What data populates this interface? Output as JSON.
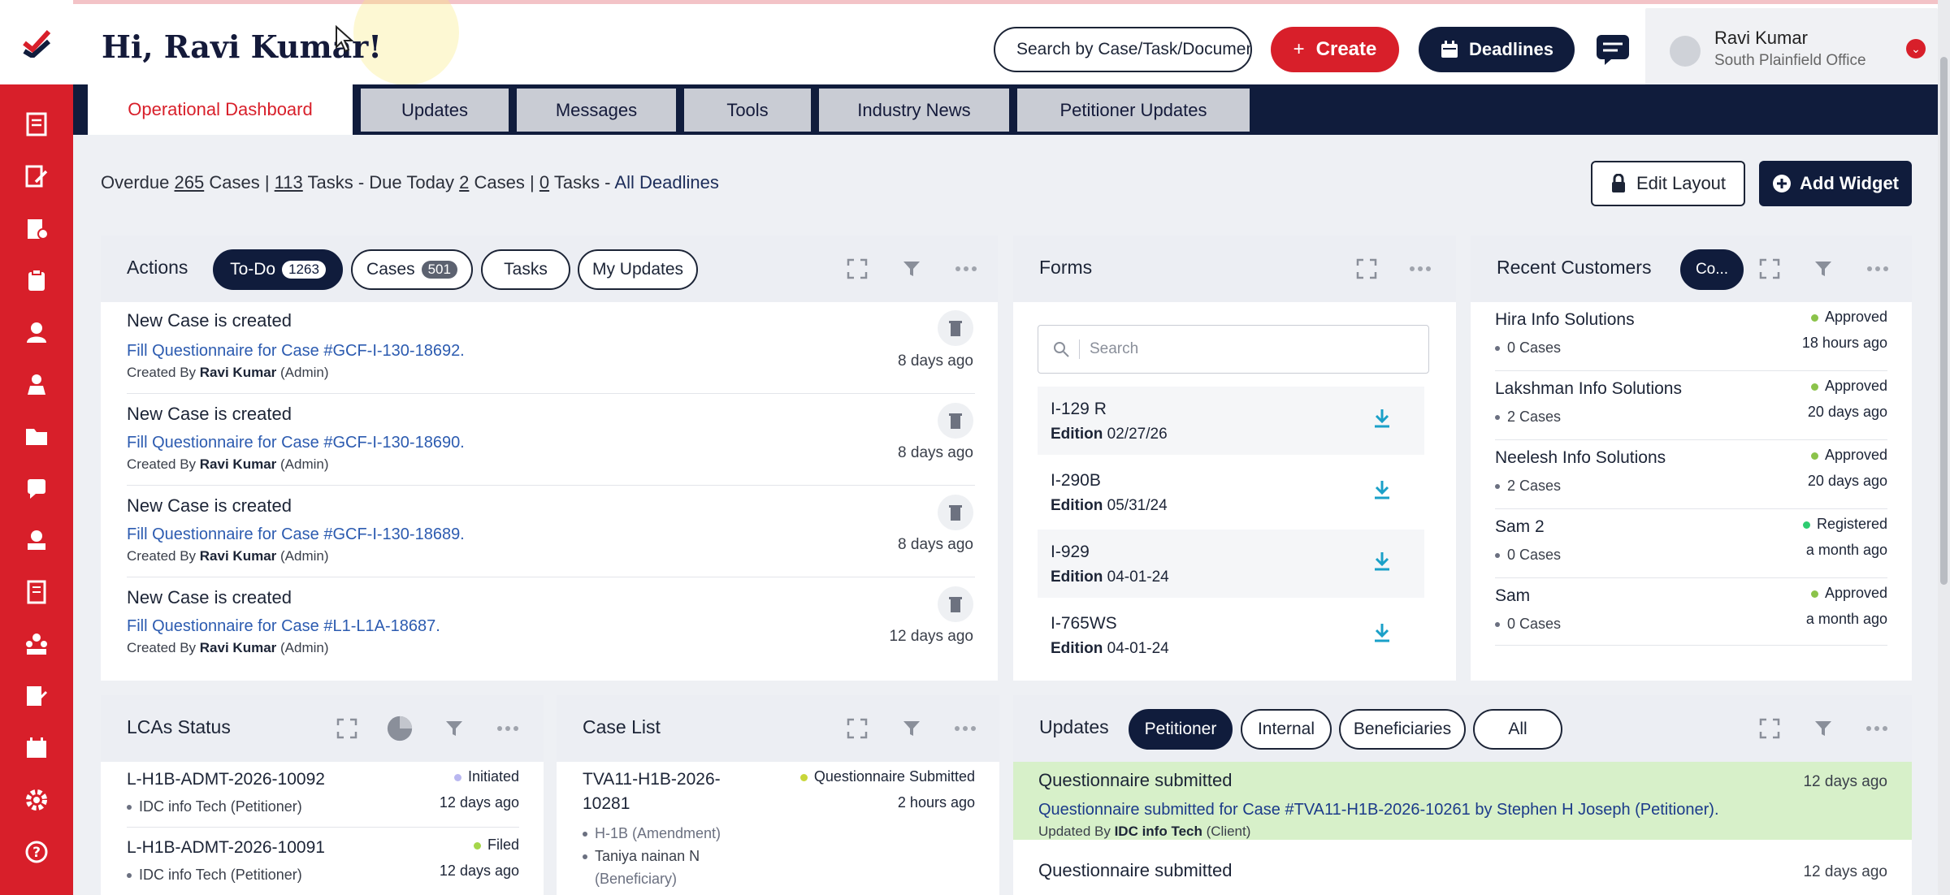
{
  "header": {
    "greeting": "Hi, Ravi Kumar!",
    "search_placeholder": "Search by Case/Task/Document",
    "create_label": "Create",
    "deadlines_label": "Deadlines",
    "user_name": "Ravi Kumar",
    "user_office": "South Plainfield Office"
  },
  "tabs": [
    "Operational Dashboard",
    "Updates",
    "Messages",
    "Tools",
    "Industry News",
    "Petitioner Updates"
  ],
  "summary": {
    "overdue_label": "Overdue",
    "overdue_cases": "265",
    "cases_word": "Cases |",
    "overdue_tasks": "113",
    "tasks_due_label": "Tasks - Due Today",
    "due_cases": "2",
    "cases_word2": "Cases |",
    "due_tasks": "0",
    "tasks_word": "Tasks -",
    "all_deadlines": "All Deadlines"
  },
  "buttons": {
    "edit_layout": "Edit Layout",
    "add_widget": "Add Widget"
  },
  "actions": {
    "title": "Actions",
    "pills": {
      "todo": "To-Do",
      "todo_count": "1263",
      "cases": "Cases",
      "cases_count": "501",
      "tasks": "Tasks",
      "my_updates": "My Updates"
    },
    "items": [
      {
        "title": "New Case is created",
        "link": "Fill Questionnaire for Case #GCF-I-130-18692.",
        "created_by": "Created By",
        "user": "Ravi Kumar",
        "role": "(Admin)",
        "time": "8 days ago"
      },
      {
        "title": "New Case is created",
        "link": "Fill Questionnaire for Case #GCF-I-130-18690.",
        "created_by": "Created By",
        "user": "Ravi Kumar",
        "role": "(Admin)",
        "time": "8 days ago"
      },
      {
        "title": "New Case is created",
        "link": "Fill Questionnaire for Case #GCF-I-130-18689.",
        "created_by": "Created By",
        "user": "Ravi Kumar",
        "role": "(Admin)",
        "time": "8 days ago"
      },
      {
        "title": "New Case is created",
        "link": "Fill Questionnaire for Case #L1-L1A-18687.",
        "created_by": "Created By",
        "user": "Ravi Kumar",
        "role": "(Admin)",
        "time": "12 days ago"
      }
    ]
  },
  "forms": {
    "title": "Forms",
    "search_placeholder": "Search",
    "edition_label": "Edition",
    "items": [
      {
        "name": "I-129 R",
        "edition": "02/27/26"
      },
      {
        "name": "I-290B",
        "edition": "05/31/24"
      },
      {
        "name": "I-929",
        "edition": "04-01-24"
      },
      {
        "name": "I-765WS",
        "edition": "04-01-24"
      }
    ]
  },
  "recent_customers": {
    "title": "Recent Customers",
    "pill": "Co...",
    "items": [
      {
        "name": "Hira Info Solutions",
        "cases": "0 Cases",
        "status": "Approved",
        "time": "18 hours ago",
        "status_color": "#8bc34a"
      },
      {
        "name": "Lakshman Info Solutions",
        "cases": "2 Cases",
        "status": "Approved",
        "time": "20 days ago",
        "status_color": "#8bc34a"
      },
      {
        "name": "Neelesh Info Solutions",
        "cases": "2 Cases",
        "status": "Approved",
        "time": "20 days ago",
        "status_color": "#8bc34a"
      },
      {
        "name": "Sam 2",
        "cases": "0 Cases",
        "status": "Registered",
        "time": "a month ago",
        "status_color": "#2ecc71"
      },
      {
        "name": "Sam",
        "cases": "0 Cases",
        "status": "Approved",
        "time": "a month ago",
        "status_color": "#8bc34a"
      }
    ]
  },
  "lcas": {
    "title": "LCAs Status",
    "items": [
      {
        "id": "L-H1B-ADMT-2026-10092",
        "org": "IDC info Tech",
        "role": "(Petitioner)",
        "status": "Initiated",
        "time": "12 days ago",
        "status_color": "#b9b7f0"
      },
      {
        "id": "L-H1B-ADMT-2026-10091",
        "org": "IDC info Tech",
        "role": "(Petitioner)",
        "status": "Filed",
        "time": "12 days ago",
        "status_color": "#a5d64a"
      }
    ]
  },
  "case_list": {
    "title": "Case List",
    "items": [
      {
        "id_line1": "TVA11-H1B-2026-",
        "id_line2": "10281",
        "status": "Questionnaire Submitted",
        "time": "2 hours ago",
        "type": "H-1B (Amendment)",
        "person": "Taniya nainan N",
        "person_role": "(Beneficiary)",
        "status_color": "#c8d63a"
      }
    ]
  },
  "updates": {
    "title": "Updates",
    "pills": [
      "Petitioner",
      "Internal",
      "Beneficiaries",
      "All"
    ],
    "items": [
      {
        "title": "Questionnaire submitted",
        "text": "Questionnaire submitted for Case #TVA11-H1B-2026-10261 by Stephen H Joseph (Petitioner).",
        "updated_by": "Updated By",
        "user": "IDC info Tech",
        "role": "(Client)",
        "time": "12 days ago"
      },
      {
        "title": "Questionnaire submitted",
        "time": "12 days ago"
      }
    ]
  },
  "colors": {
    "brand_red": "#d81f2a",
    "navy": "#101c3c",
    "highlight_green": "#d7f0c9"
  }
}
